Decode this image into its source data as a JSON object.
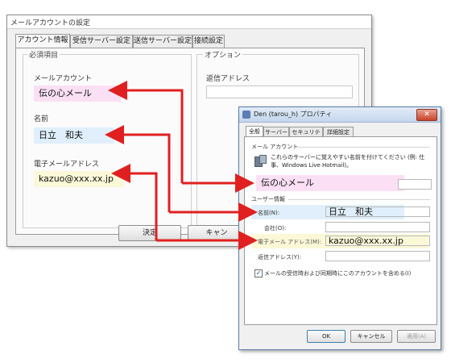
{
  "back_window": {
    "title": "メールアカウントの設定",
    "tabs": [
      "アカウント情報",
      "受信サーバー設定",
      "送信サーバー設定",
      "接続設定"
    ],
    "required_group": "必須項目",
    "option_group": "オプション",
    "mail_account_label": "メールアカウント",
    "mail_account_value": "伝の心メール",
    "name_label": "名前",
    "name_value": "日立　和夫",
    "email_label": "電子メールアドレス",
    "email_value": "kazuo@xxx.xx.jp",
    "reply_label": "返信アドレス",
    "ok_button": "決定",
    "cancel_button": "キャン"
  },
  "front_window": {
    "title": "Den (tarou_h) プロパティ",
    "tabs": [
      "全般",
      "サーバー",
      "セキュリティ",
      "詳細設定"
    ],
    "mail_account_section": "メール アカウント",
    "description": "これらのサーバーに覚えやすい名前を付けてください (例: 仕事、Windows Live Hotmail)。",
    "account_name": "伝の心メール",
    "user_info_section": "ユーザー情報",
    "name_label": "名前(N):",
    "name_value": "日立　和夫",
    "company_label": "会社(O):",
    "email_label": "電子メール アドレス(M):",
    "email_value": "kazuo@xxx.xx.jp",
    "reply_label": "返信アドレス(Y):",
    "include_checkbox_label": "メールの受信時および同期時にこのアカウントを含める(I)",
    "include_checked": true,
    "ok_button": "OK",
    "cancel_button": "キャンセル",
    "apply_button": "適用(A)"
  },
  "colors": {
    "arrow": "#e02020",
    "highlight_pink": "#fbe0f5",
    "highlight_blue": "#e0effb",
    "highlight_yellow": "#fbf8d8"
  }
}
